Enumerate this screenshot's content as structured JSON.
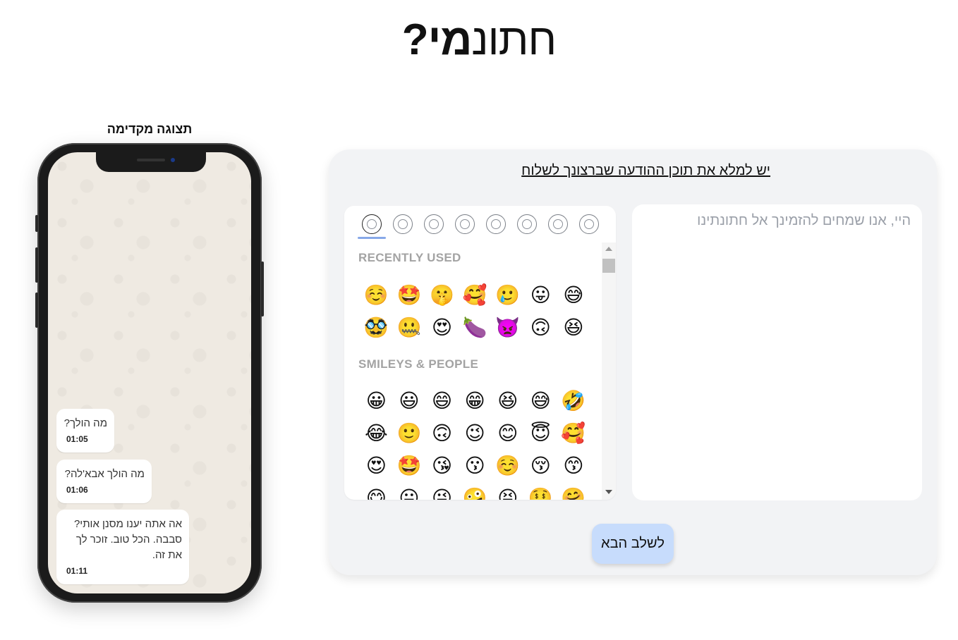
{
  "site": {
    "title_light": "חתונ",
    "title_bold": "מי?"
  },
  "preview": {
    "title": "תצוגה מקדימה",
    "messages": [
      {
        "text": "מה הולך?",
        "time": "01:05"
      },
      {
        "text": "מה הולך אבא'לה?",
        "time": "01:06"
      },
      {
        "text": "אה אתה יענו מסנן אותי? סבבה. הכל טוב. זוכר לך את זה.",
        "time": "01:11"
      }
    ]
  },
  "editor": {
    "heading": "יש למלא את תוכן ההודעה שברצונך לשלוח",
    "message_placeholder": "היי, אנו שמחים להזמינך אל חתונתינו",
    "message_value": "",
    "next_label": "לשלב הבא"
  },
  "emoji_picker": {
    "tabs": [
      {
        "icon": "recent-clock-icon",
        "active": true
      },
      {
        "icon": "smiley-icon"
      },
      {
        "icon": "animal-icon"
      },
      {
        "icon": "food-icon"
      },
      {
        "icon": "building-icon"
      },
      {
        "icon": "ball-icon"
      },
      {
        "icon": "alarm-clock-icon"
      },
      {
        "icon": "heart-icon"
      },
      {
        "icon": "flag-icon"
      }
    ],
    "recently_used_title": "RECENTLY USED",
    "recently_used": [
      "☺️",
      "🤩",
      "🤫",
      "🥰",
      "🥲",
      "😛",
      "😅",
      "🥸",
      "🤐",
      "😍",
      "🍆",
      "👿",
      "🙃",
      "😆"
    ],
    "smileys_title": "SMILEYS & PEOPLE",
    "smileys": [
      "😀",
      "😃",
      "😄",
      "😁",
      "😆",
      "😅",
      "🤣",
      "😂",
      "🙂",
      "🙃",
      "😉",
      "😊",
      "😇",
      "🥰",
      "😍",
      "🤩",
      "😘",
      "😗",
      "☺️",
      "😚",
      "😙",
      "😋",
      "😛",
      "😜",
      "🤪",
      "😝",
      "🤑",
      "🤗"
    ]
  },
  "colors": {
    "card_bg": "#f2f3f5",
    "next_button_bg": "#c7dcfc",
    "chat_bg": "#efeae2",
    "tab_underline": "#87a8e8"
  }
}
